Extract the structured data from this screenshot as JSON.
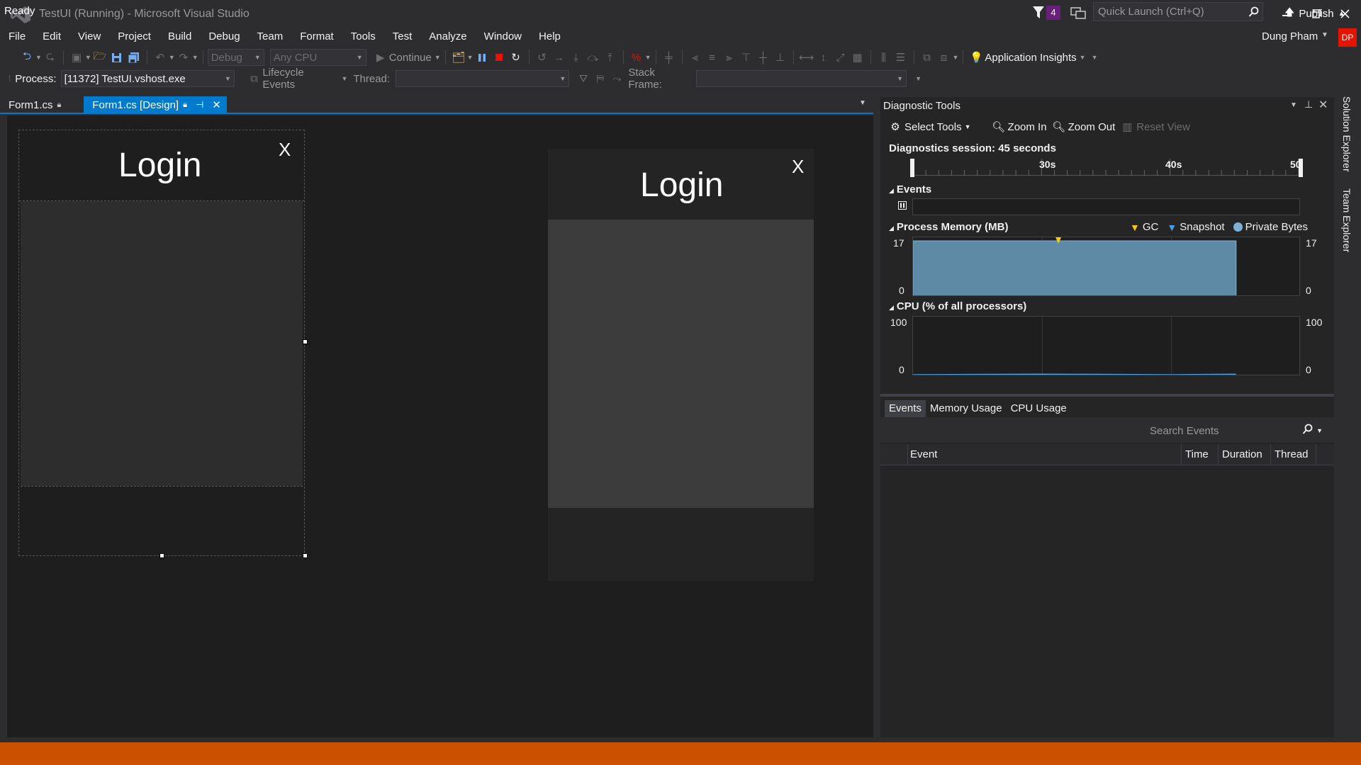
{
  "titlebar": {
    "window_title": "TestUI (Running) - Microsoft Visual Studio",
    "notification_count": "4",
    "quick_launch_placeholder": "Quick Launch (Ctrl+Q)"
  },
  "menu": [
    "File",
    "Edit",
    "View",
    "Project",
    "Build",
    "Debug",
    "Team",
    "Format",
    "Tools",
    "Test",
    "Analyze",
    "Window",
    "Help"
  ],
  "user": {
    "name": "Dung Pham",
    "initials": "DP",
    "avatar_color": "#e51400"
  },
  "toolbar": {
    "config": "Debug",
    "platform": "Any CPU",
    "continue_label": "Continue",
    "app_insights_label": "Application Insights"
  },
  "debug_toolbar": {
    "process_label": "Process:",
    "process_value": "[11372] TestUI.vshost.exe",
    "lifecycle_label": "Lifecycle Events",
    "thread_label": "Thread:",
    "stack_frame_label": "Stack Frame:"
  },
  "doc_tabs": {
    "tab1": "Form1.cs",
    "tab2": "Form1.cs [Design]"
  },
  "designer": {
    "form_title": "Login",
    "close_text": "X"
  },
  "running_form": {
    "form_title": "Login",
    "close_text": "X"
  },
  "diagnostics": {
    "title": "Diagnostic Tools",
    "select_tools": "Select Tools",
    "zoom_in": "Zoom In",
    "zoom_out": "Zoom Out",
    "reset_view": "Reset View",
    "session": "Diagnostics session: 45 seconds",
    "timeline_ticks": [
      "30s",
      "40s",
      "50"
    ],
    "events_title": "Events",
    "memory_title": "Process Memory (MB)",
    "legend_gc": "GC",
    "legend_snapshot": "Snapshot",
    "legend_private": "Private Bytes",
    "memory_max": "17",
    "memory_min": "0",
    "cpu_title": "CPU (% of all processors)",
    "cpu_max": "100",
    "cpu_min": "0",
    "tabs": [
      "Events",
      "Memory Usage",
      "CPU Usage"
    ],
    "search_placeholder": "Search Events",
    "columns": [
      "Event",
      "Time",
      "Duration",
      "Thread"
    ]
  },
  "side_tabs": [
    "Solution Explorer",
    "Team Explorer"
  ],
  "status": {
    "text": "Ready",
    "publish": "Publish",
    "bar_color": "#ca5100"
  },
  "chart_data": [
    {
      "type": "area",
      "title": "Process Memory (MB)",
      "series": [
        {
          "name": "Private Bytes",
          "x": [
            20,
            25,
            30,
            35,
            40,
            45
          ],
          "values": [
            16,
            16,
            16,
            16,
            16,
            16
          ]
        }
      ],
      "ylim": [
        0,
        17
      ],
      "xlim": [
        20,
        50
      ]
    },
    {
      "type": "line",
      "title": "CPU (% of all processors)",
      "series": [
        {
          "name": "CPU",
          "x": [
            20,
            30,
            40,
            45
          ],
          "values": [
            0,
            1,
            0,
            1
          ]
        }
      ],
      "ylim": [
        0,
        100
      ],
      "xlim": [
        20,
        50
      ]
    }
  ]
}
